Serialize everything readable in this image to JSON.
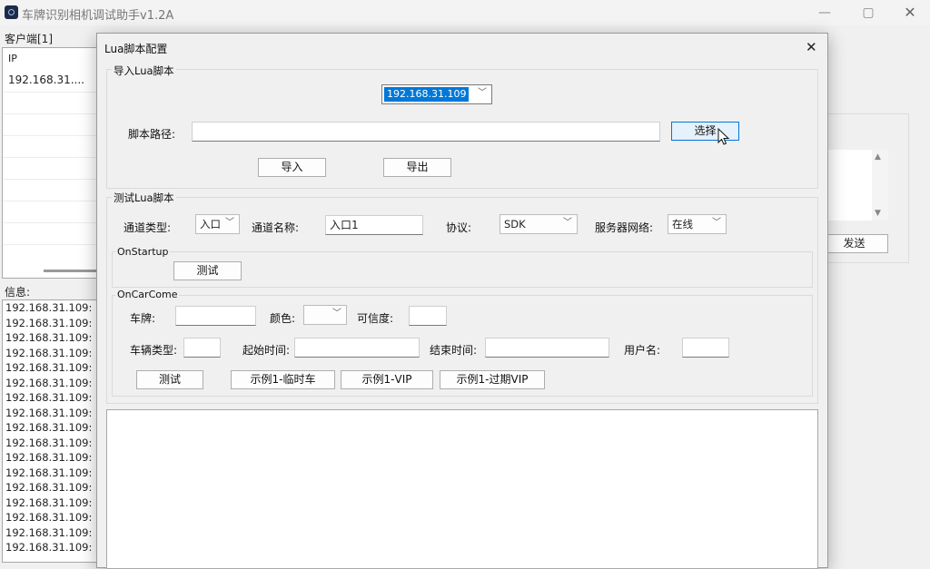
{
  "window": {
    "title": "车牌识别相机调试助手v1.2A",
    "minimize": "—",
    "maximize": "▢",
    "close": "✕"
  },
  "clients": {
    "label": "客户端[1]",
    "column_ip": "IP",
    "rows": [
      "192.168.31...."
    ]
  },
  "info": {
    "label": "信息:",
    "lines": [
      "192.168.31.109:",
      "192.168.31.109:",
      "192.168.31.109:",
      "192.168.31.109:",
      "192.168.31.109:",
      "192.168.31.109:",
      "192.168.31.109:",
      "192.168.31.109:",
      "192.168.31.109:",
      "192.168.31.109:",
      "192.168.31.109:",
      "192.168.31.109:",
      "192.168.31.109:",
      "192.168.31.109:",
      "192.168.31.109:",
      "192.168.31.109:",
      "192.168.31.109:"
    ]
  },
  "right_panel": {
    "send_label": "发送"
  },
  "dialog": {
    "title": "Lua脚本配置",
    "close": "✕",
    "import_group": {
      "label": "导入Lua脚本",
      "ip_selected": "192.168.31.109",
      "path_label": "脚本路径:",
      "path_value": "",
      "choose_label": "选择",
      "import_label": "导入",
      "export_label": "导出"
    },
    "test_group": {
      "label": "测试Lua脚本",
      "channel_type_label": "通道类型:",
      "channel_type_value": "入口",
      "channel_name_label": "通道名称:",
      "channel_name_value": "入口1",
      "protocol_label": "协议:",
      "protocol_value": "SDK",
      "server_network_label": "服务器网络:",
      "server_network_value": "在线",
      "onstartup": {
        "label": "OnStartup",
        "test_label": "测试"
      },
      "oncarcome": {
        "label": "OnCarCome",
        "plate_label": "车牌:",
        "color_label": "颜色:",
        "confidence_label": "可信度:",
        "vehicle_type_label": "车辆类型:",
        "start_time_label": "起始时间:",
        "end_time_label": "结束时间:",
        "username_label": "用户名:",
        "test_label": "测试",
        "example_temp_label": "示例1-临时车",
        "example_vip_label": "示例1-VIP",
        "example_expired_vip_label": "示例1-过期VIP"
      }
    }
  },
  "icons": {
    "app": "app-icon",
    "dropdown": "chevron-down-icon",
    "cursor": "mouse-cursor-icon"
  }
}
